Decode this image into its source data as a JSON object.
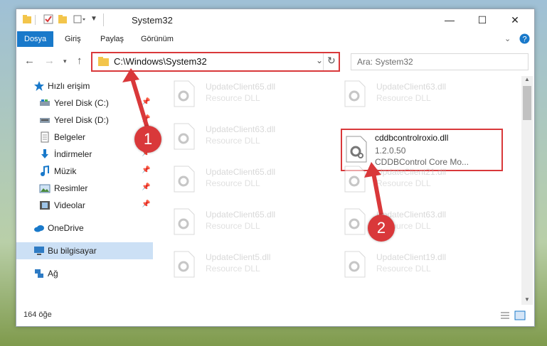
{
  "window": {
    "title": "System32",
    "controls": {
      "minimize": "—",
      "maximize": "☐",
      "close": "✕"
    }
  },
  "ribbon": {
    "tabs": [
      {
        "label": "Dosya",
        "active": true
      },
      {
        "label": "Giriş"
      },
      {
        "label": "Paylaş"
      },
      {
        "label": "Görünüm"
      }
    ]
  },
  "address": {
    "path": "C:\\Windows\\System32",
    "search_placeholder": "Ara: System32"
  },
  "nav": {
    "items": [
      {
        "label": "Hızlı erişim",
        "icon": "star-icon"
      },
      {
        "label": "Yerel Disk (C:)",
        "icon": "drive-icon",
        "pinned": true
      },
      {
        "label": "Yerel Disk (D:)",
        "icon": "drive-icon",
        "pinned": true
      },
      {
        "label": "Belgeler",
        "icon": "document-icon",
        "pinned": true
      },
      {
        "label": "İndirmeler",
        "icon": "download-icon",
        "pinned": true
      },
      {
        "label": "Müzik",
        "icon": "music-icon",
        "pinned": true
      },
      {
        "label": "Resimler",
        "icon": "picture-icon",
        "pinned": true
      },
      {
        "label": "Videolar",
        "icon": "video-icon",
        "pinned": true
      },
      {
        "label": "OneDrive",
        "icon": "cloud-icon"
      },
      {
        "label": "Bu bilgisayar",
        "icon": "computer-icon",
        "selected": true
      },
      {
        "label": "Ağ",
        "icon": "network-icon"
      }
    ]
  },
  "files": [
    {
      "name": "UpdateClient65.dll",
      "type": "Resource DLL"
    },
    {
      "name": "UpdateClient63.dll",
      "type": "Resource DLL"
    },
    {
      "name": "UpdateClient63.dll",
      "type": "Resource DLL"
    },
    {
      "name": "UpdateClient65.dll",
      "type": "Resource DLL"
    },
    {
      "name": "UpdateClient21.dll",
      "type": "Resource DLL"
    },
    {
      "name": "UpdateClient65.dll",
      "type": "Resource DLL"
    },
    {
      "name": "UpdateClient63.dll",
      "type": "Resource DLL"
    },
    {
      "name": "UpdateClient5.dll",
      "type": "Resource DLL"
    },
    {
      "name": "UpdateClient19.dll",
      "type": "Resource DLL"
    }
  ],
  "highlighted_file": {
    "name": "cddbcontrolroxio.dll",
    "version": "1.2.0.50",
    "description": "CDDBControl Core Mo..."
  },
  "status": {
    "count": "164 öğe"
  },
  "annotations": {
    "badge1": "1",
    "badge2": "2"
  },
  "colors": {
    "accent": "#1979ca",
    "annotation": "#d9383a"
  }
}
